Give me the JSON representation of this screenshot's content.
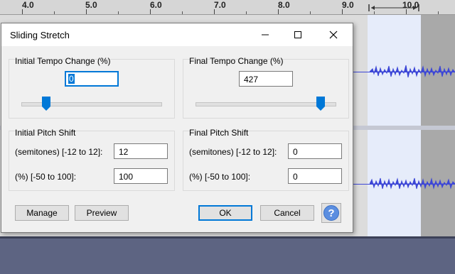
{
  "ruler": {
    "labels": [
      "4.0",
      "5.0",
      "6.0",
      "7.0",
      "8.0",
      "9.0",
      "10.0"
    ]
  },
  "dialog": {
    "title": "Sliding Stretch",
    "initial_tempo": {
      "label": "Initial Tempo Change (%)",
      "value": "0",
      "slider_fraction": 0.18
    },
    "final_tempo": {
      "label": "Final Tempo Change (%)",
      "value": "427",
      "slider_fraction": 0.9
    },
    "initial_pitch": {
      "label": "Initial Pitch Shift",
      "semitones_label": "(semitones) [-12 to 12]:",
      "semitones_value": "12",
      "percent_label": "(%) [-50 to 100]:",
      "percent_value": "100"
    },
    "final_pitch": {
      "label": "Final Pitch Shift",
      "semitones_label": "(semitones) [-12 to 12]:",
      "semitones_value": "0",
      "percent_label": "(%) [-50 to 100]:",
      "percent_value": "0"
    },
    "buttons": {
      "manage": "Manage",
      "preview": "Preview",
      "ok": "OK",
      "cancel": "Cancel",
      "help": "?"
    }
  },
  "colors": {
    "accent": "#0078d7",
    "waveform": "#3c46d6",
    "selection": "#e6ecfa"
  },
  "icons": [
    "minimize-icon",
    "maximize-icon",
    "close-icon",
    "slider-thumb-icon",
    "help-icon"
  ]
}
